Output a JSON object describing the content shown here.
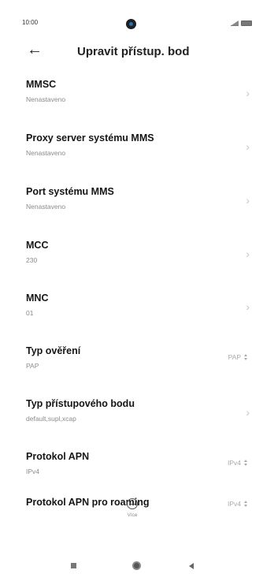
{
  "status_bar": {
    "time": "10:00",
    "icons": [
      "signal-icon",
      "battery-icon"
    ]
  },
  "header": {
    "back_icon": "arrow-left-icon",
    "title": "Upravit přístup. bod"
  },
  "items": [
    {
      "title": "MMSC",
      "subtitle": "Nenastaveno",
      "control": "chevron"
    },
    {
      "title": "Proxy server systému MMS",
      "subtitle": "Nenastaveno",
      "control": "chevron"
    },
    {
      "title": "Port systému MMS",
      "subtitle": "Nenastaveno",
      "control": "chevron"
    },
    {
      "title": "MCC",
      "subtitle": "230",
      "control": "chevron"
    },
    {
      "title": "MNC",
      "subtitle": "01",
      "control": "chevron"
    },
    {
      "title": "Typ ověření",
      "subtitle": "PAP",
      "control": "dropdown",
      "value": "PAP"
    },
    {
      "title": "Typ přístupového bodu",
      "subtitle": "default,supl,xcap",
      "control": "chevron"
    },
    {
      "title": "Protokol APN",
      "subtitle": "IPv4",
      "control": "dropdown",
      "value": "IPv4"
    },
    {
      "title": "Protokol APN pro roaming",
      "subtitle": "",
      "control": "dropdown",
      "value": "IPv4"
    }
  ],
  "footer": {
    "more_label": "Více",
    "more_icon": "minus-circle-icon"
  },
  "nav": {
    "icons": [
      "recent-apps-icon",
      "home-icon",
      "back-triangle-icon"
    ]
  }
}
